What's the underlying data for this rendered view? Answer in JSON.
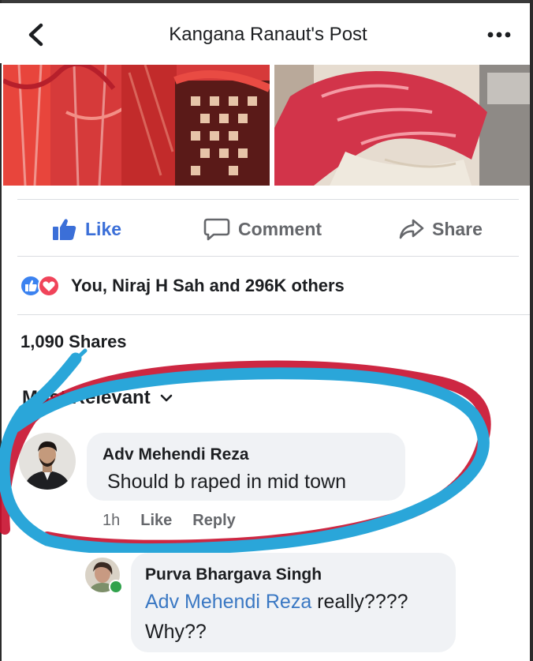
{
  "header": {
    "title": "Kangana Ranaut's Post",
    "back_icon": "chevron-left-icon",
    "more_icon": "more-horizontal-icon"
  },
  "actions": {
    "like_label": "Like",
    "comment_label": "Comment",
    "share_label": "Share",
    "like_color": "#3b6fd8"
  },
  "reactions": {
    "text": "You, Niraj H Sah and 296K others",
    "icons": [
      "like-reaction-icon",
      "love-reaction-icon"
    ]
  },
  "shares": {
    "text": "1,090 Shares"
  },
  "comments_sort": {
    "label": "Most Relevant"
  },
  "comments": [
    {
      "author": "Adv Mehendi Reza",
      "text": "Should b raped in mid town",
      "time": "1h",
      "like_label": "Like",
      "reply_label": "Reply"
    },
    {
      "author": "Purva Bhargava Singh",
      "mention": "Adv Mehendi Reza",
      "text_after_mention": " really????",
      "text_line2": "Why??"
    }
  ],
  "colors": {
    "annotation_blue": "#2aa6d9",
    "annotation_red": "#c8102e",
    "mention_blue": "#3a78c3"
  }
}
